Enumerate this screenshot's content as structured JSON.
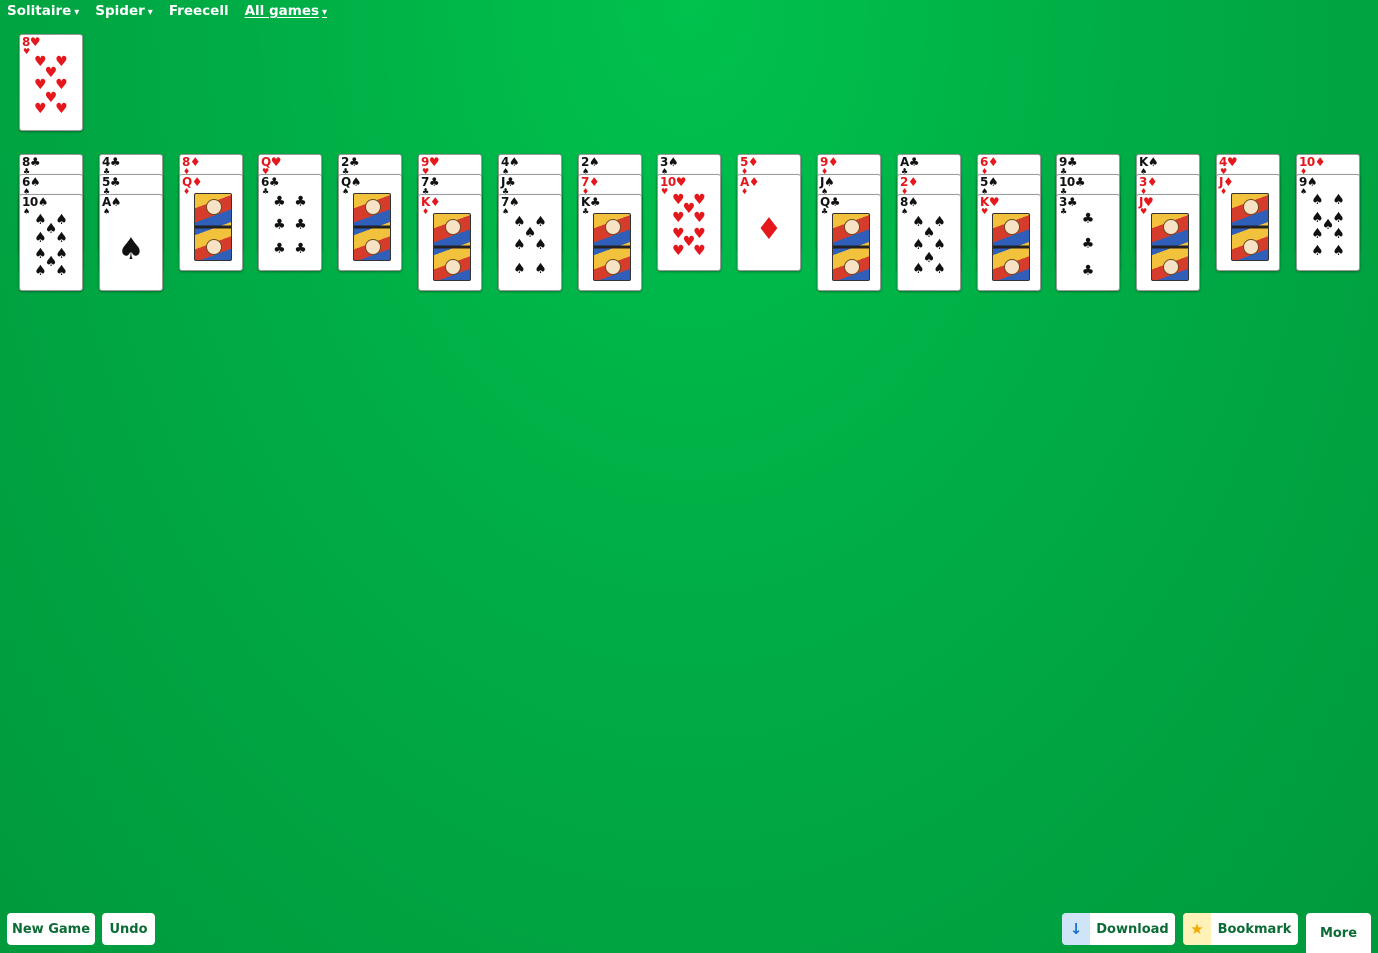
{
  "nav": {
    "items": [
      {
        "label": "Solitaire",
        "caret": "▾"
      },
      {
        "label": "Spider",
        "caret": "▾"
      },
      {
        "label": "Freecell",
        "caret": ""
      },
      {
        "label": "All games",
        "caret": "▾",
        "underlined": true
      }
    ]
  },
  "stock": {
    "rank": "8",
    "suit": "♥"
  },
  "tableau": [
    [
      {
        "rank": "8",
        "suit": "♣"
      },
      {
        "rank": "6",
        "suit": "♠"
      },
      {
        "rank": "10",
        "suit": "♠"
      }
    ],
    [
      {
        "rank": "4",
        "suit": "♣"
      },
      {
        "rank": "5",
        "suit": "♣"
      },
      {
        "rank": "A",
        "suit": "♠"
      }
    ],
    [
      {
        "rank": "8",
        "suit": "♦"
      },
      {
        "rank": "Q",
        "suit": "♦"
      }
    ],
    [
      {
        "rank": "Q",
        "suit": "♥"
      },
      {
        "rank": "6",
        "suit": "♣"
      }
    ],
    [
      {
        "rank": "2",
        "suit": "♣"
      },
      {
        "rank": "Q",
        "suit": "♠"
      }
    ],
    [
      {
        "rank": "9",
        "suit": "♥"
      },
      {
        "rank": "7",
        "suit": "♣"
      },
      {
        "rank": "K",
        "suit": "♦"
      }
    ],
    [
      {
        "rank": "4",
        "suit": "♠"
      },
      {
        "rank": "J",
        "suit": "♣"
      },
      {
        "rank": "7",
        "suit": "♠"
      }
    ],
    [
      {
        "rank": "2",
        "suit": "♠"
      },
      {
        "rank": "7",
        "suit": "♦"
      },
      {
        "rank": "K",
        "suit": "♣"
      }
    ],
    [
      {
        "rank": "3",
        "suit": "♠"
      },
      {
        "rank": "10",
        "suit": "♥"
      }
    ],
    [
      {
        "rank": "5",
        "suit": "♦"
      },
      {
        "rank": "A",
        "suit": "♦"
      }
    ],
    [
      {
        "rank": "9",
        "suit": "♦"
      },
      {
        "rank": "J",
        "suit": "♠"
      },
      {
        "rank": "Q",
        "suit": "♣"
      }
    ],
    [
      {
        "rank": "A",
        "suit": "♣"
      },
      {
        "rank": "2",
        "suit": "♦"
      },
      {
        "rank": "8",
        "suit": "♠"
      }
    ],
    [
      {
        "rank": "6",
        "suit": "♦"
      },
      {
        "rank": "5",
        "suit": "♠"
      },
      {
        "rank": "K",
        "suit": "♥"
      }
    ],
    [
      {
        "rank": "9",
        "suit": "♣"
      },
      {
        "rank": "10",
        "suit": "♣"
      },
      {
        "rank": "3",
        "suit": "♣"
      }
    ],
    [
      {
        "rank": "K",
        "suit": "♠"
      },
      {
        "rank": "3",
        "suit": "♦"
      },
      {
        "rank": "J",
        "suit": "♥"
      }
    ],
    [
      {
        "rank": "4",
        "suit": "♥"
      },
      {
        "rank": "J",
        "suit": "♦"
      }
    ],
    [
      {
        "rank": "10",
        "suit": "♦"
      },
      {
        "rank": "9",
        "suit": "♠"
      }
    ]
  ],
  "buttons": {
    "new_game": "New Game",
    "undo": "Undo",
    "download": "Download",
    "bookmark": "Bookmark",
    "more": "More"
  },
  "icons": {
    "download": "arrow-down-icon",
    "bookmark": "star-icon"
  },
  "colors": {
    "felt": "#00ad45",
    "button_text": "#0b6b34",
    "red_suit": "#e4171c"
  }
}
